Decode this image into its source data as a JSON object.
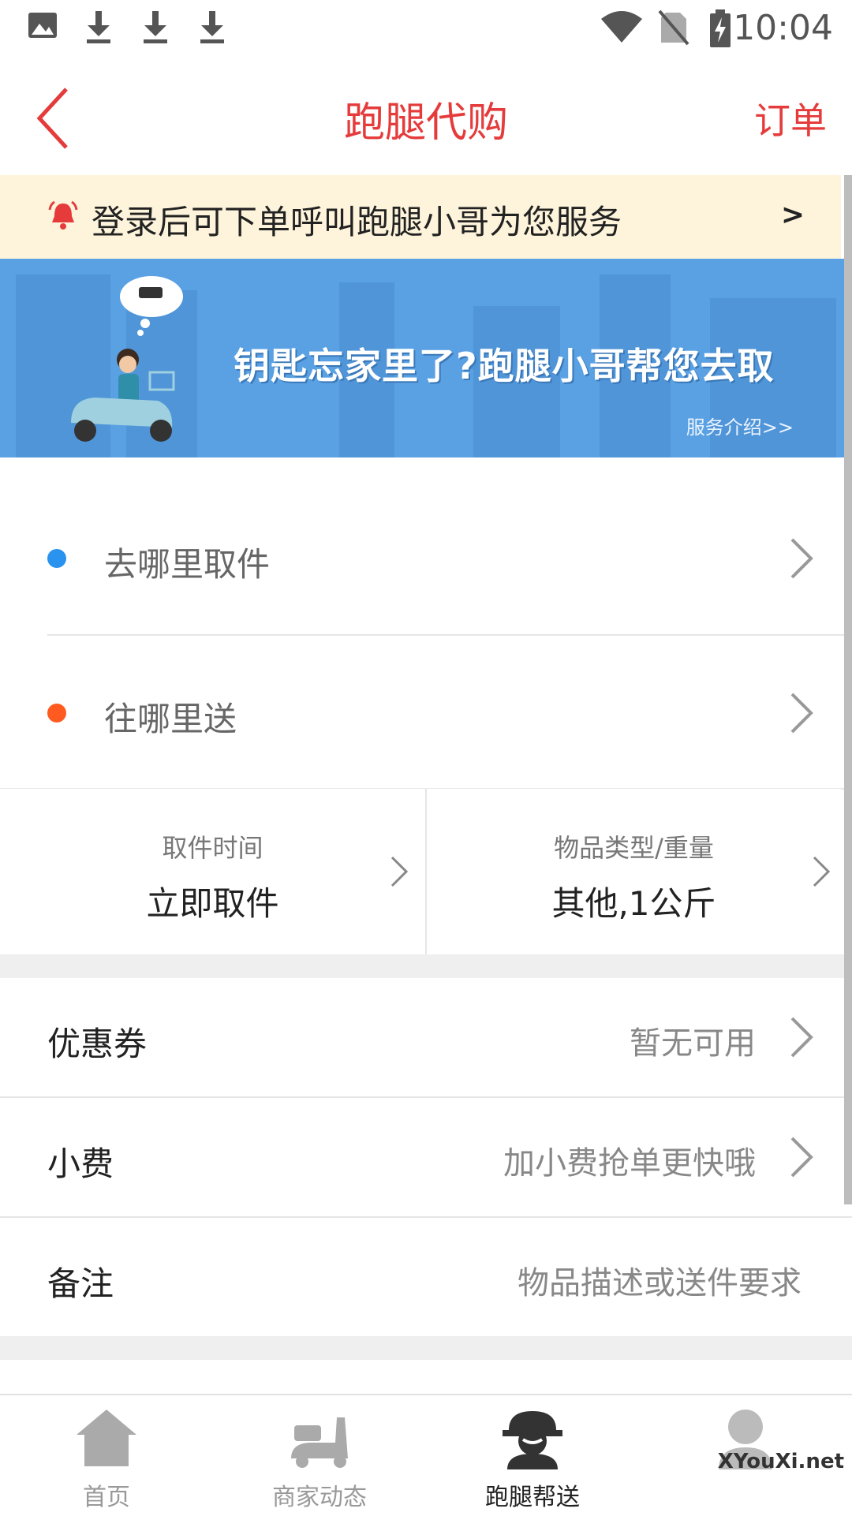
{
  "status_bar": {
    "time": "10:04",
    "icons": [
      "image-icon",
      "download-icon",
      "download-icon",
      "download-icon",
      "wifi-icon",
      "no-sim-icon",
      "battery-charging-icon"
    ]
  },
  "header": {
    "title": "跑腿代购",
    "right_action": "订单",
    "back_icon": "chevron-left-icon"
  },
  "notice": {
    "text": "登录后可下单呼叫跑腿小哥为您服务",
    "arrow": ">"
  },
  "banner": {
    "slogan": "钥匙忘家里了?跑腿小哥帮您去取",
    "link": "服务介绍>>"
  },
  "addresses": [
    {
      "label": "去哪里取件",
      "dot_color": "#2a92ef"
    },
    {
      "label": "往哪里送",
      "dot_color": "#ff5a1f"
    }
  ],
  "pickup_time": {
    "label": "取件时间",
    "value": "立即取件"
  },
  "item_type": {
    "label": "物品类型/重量",
    "value": "其他,1公斤"
  },
  "options": [
    {
      "label": "优惠券",
      "value": "暂无可用"
    },
    {
      "label": "小费",
      "value": "加小费抢单更快哦"
    },
    {
      "label": "备注",
      "placeholder": "物品描述或送件要求"
    }
  ],
  "tabs": [
    {
      "label": "首页",
      "icon": "home-icon",
      "active": false
    },
    {
      "label": "商家动态",
      "icon": "scooter-icon",
      "active": false
    },
    {
      "label": "跑腿帮送",
      "icon": "courier-icon",
      "active": true
    },
    {
      "label": "",
      "icon": "user-icon",
      "active": false
    }
  ],
  "watermark": "XYouXi.net",
  "colors": {
    "accent": "#e53b3b",
    "notice_bg": "#fdf4db",
    "banner_bg": "#5aa1e4"
  }
}
